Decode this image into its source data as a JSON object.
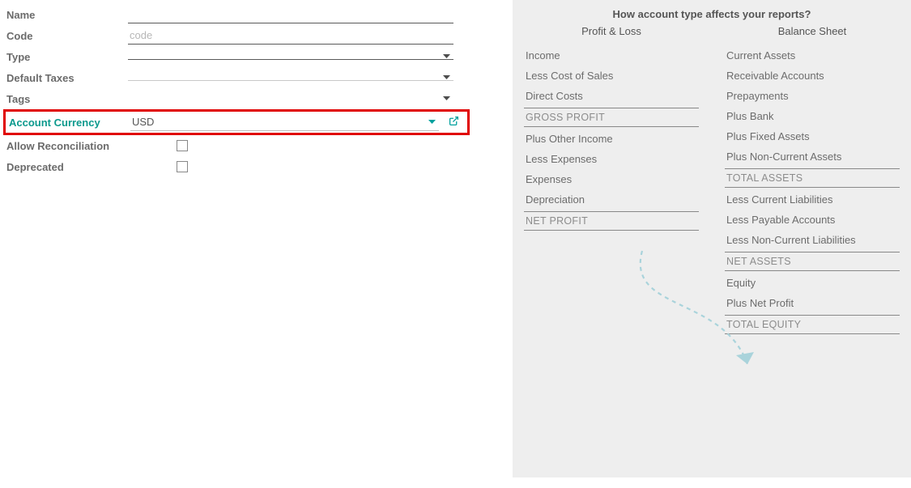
{
  "form": {
    "name": {
      "label": "Name",
      "value": ""
    },
    "code": {
      "label": "Code",
      "placeholder": "code",
      "value": ""
    },
    "type": {
      "label": "Type",
      "value": ""
    },
    "default_taxes": {
      "label": "Default Taxes",
      "value": ""
    },
    "tags": {
      "label": "Tags",
      "value": ""
    },
    "account_currency": {
      "label": "Account Currency",
      "value": "USD"
    },
    "allow_reconciliation": {
      "label": "Allow Reconciliation",
      "checked": false
    },
    "deprecated": {
      "label": "Deprecated",
      "checked": false
    }
  },
  "info_panel": {
    "title": "How account type affects your reports?",
    "profit_loss": {
      "heading": "Profit & Loss",
      "items": [
        "Income",
        "Less Cost of Sales",
        "Direct Costs"
      ],
      "gross_profit": "GROSS PROFIT",
      "items2": [
        "Plus Other Income",
        "Less Expenses",
        "Expenses",
        "Depreciation"
      ],
      "net_profit": "NET PROFIT"
    },
    "balance_sheet": {
      "heading": "Balance Sheet",
      "items": [
        "Current Assets",
        "Receivable Accounts",
        "Prepayments",
        "Plus Bank",
        "Plus Fixed Assets",
        "Plus Non-Current Assets"
      ],
      "total_assets": "TOTAL ASSETS",
      "items2": [
        "Less Current Liabilities",
        "Less Payable Accounts",
        "Less Non-Current Liabilities"
      ],
      "net_assets": "NET ASSETS",
      "items3": [
        "Equity",
        "Plus Net Profit"
      ],
      "total_equity": "TOTAL EQUITY"
    }
  }
}
